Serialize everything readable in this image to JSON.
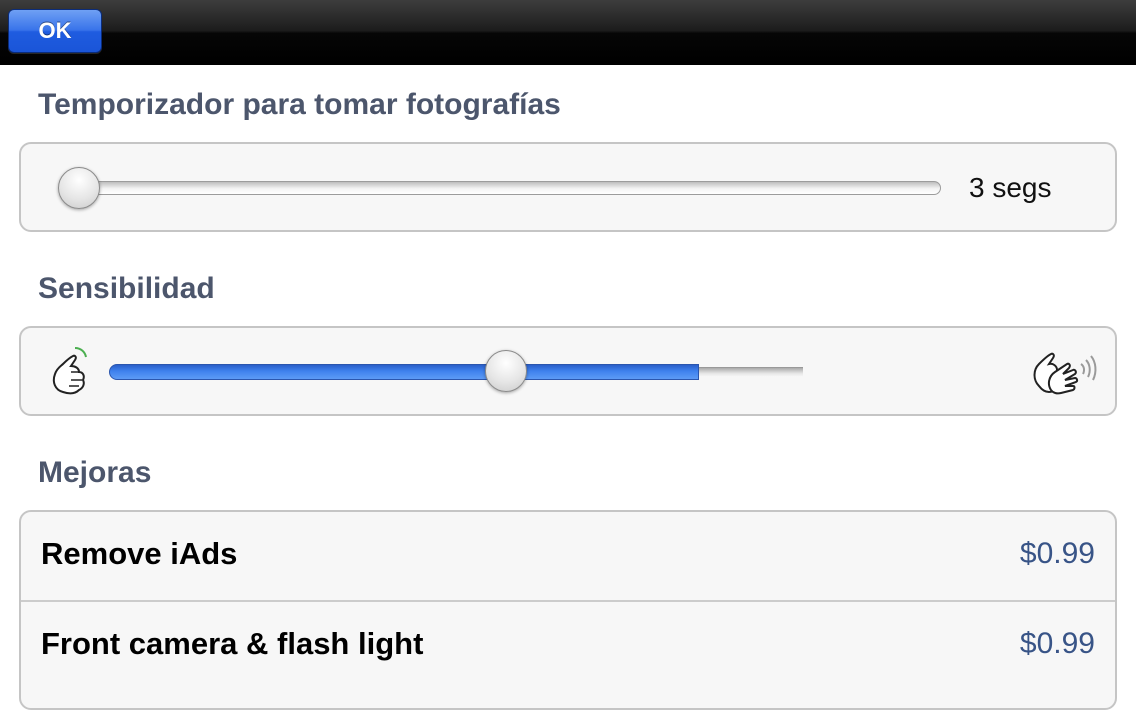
{
  "navbar": {
    "ok_label": "OK"
  },
  "timer": {
    "title": "Temporizador para tomar fotografías",
    "value_label": "3 segs",
    "slider_level": 0.0
  },
  "sensitivity": {
    "title": "Sensibilidad",
    "slider_level": 0.57,
    "low_icon": "tap-hand-icon",
    "high_icon": "clap-hands-icon"
  },
  "upgrades": {
    "title": "Mejoras",
    "items": [
      {
        "label": "Remove iAds",
        "price": "$0.99"
      },
      {
        "label": "Front camera & flash light",
        "price": "$0.99"
      }
    ]
  },
  "colors": {
    "accent_blue": "#3873ea",
    "section_title": "#4c566c",
    "price": "#385487"
  }
}
